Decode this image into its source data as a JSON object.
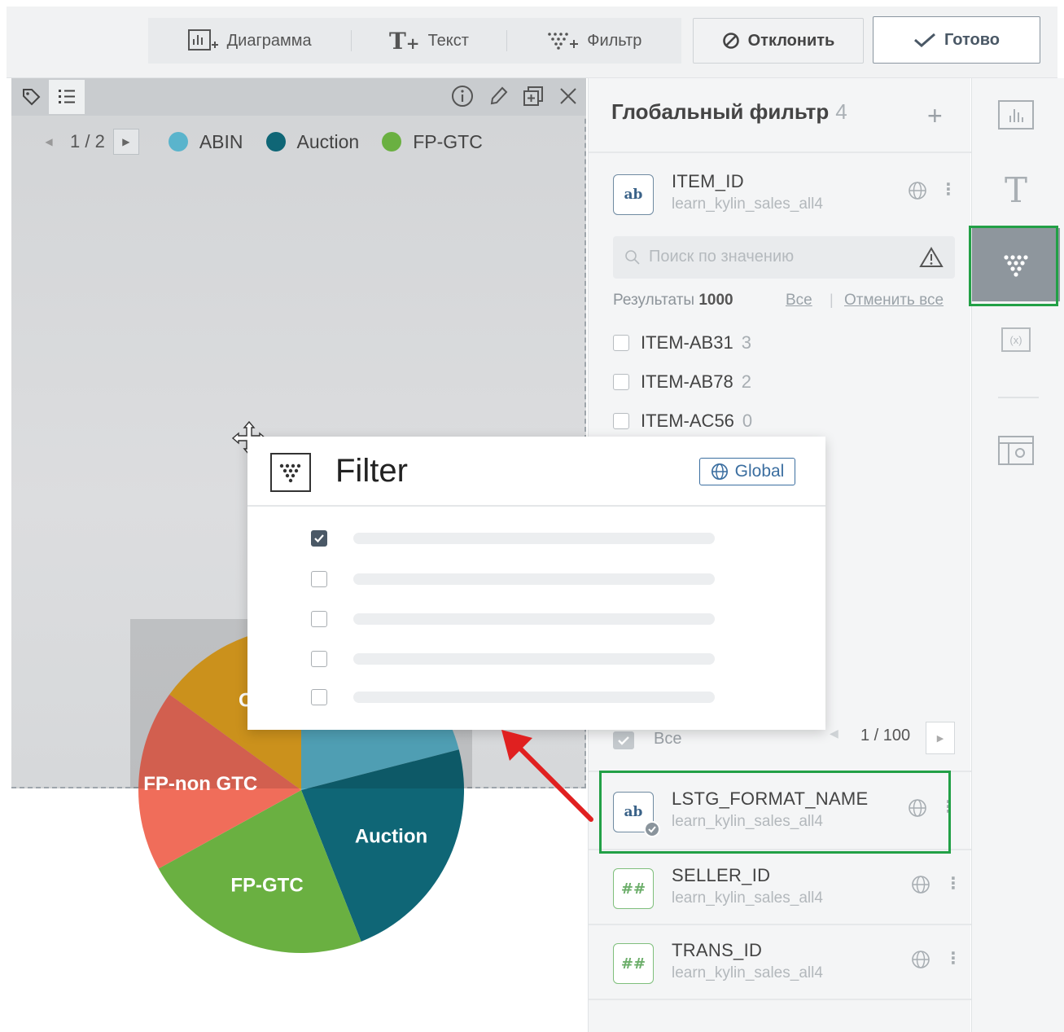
{
  "toolbar": {
    "chart_label": "Диаграмма",
    "text_label": "Текст",
    "filter_label": "Фильтр",
    "reject_label": "Отклонить",
    "done_label": "Готово"
  },
  "widget": {
    "page": "1 / 2",
    "legend": [
      {
        "label": "ABIN",
        "color": "#5ab4cc"
      },
      {
        "label": "Auction",
        "color": "#0f6676"
      },
      {
        "label": "FP-GTC",
        "color": "#6ab041"
      }
    ]
  },
  "chart_data": {
    "type": "pie",
    "slices": [
      {
        "label": "ABIN",
        "value": 21,
        "color": "#5ab4cc"
      },
      {
        "label": "Auction",
        "value": 23,
        "color": "#0f6676"
      },
      {
        "label": "FP-GTC",
        "value": 23,
        "color": "#6ab041"
      },
      {
        "label": "FP-non GTC",
        "value": 18,
        "color": "#f06d5a"
      },
      {
        "label": "Others",
        "value": 15,
        "color": "#e8a520"
      }
    ],
    "visible_labels": [
      "Oth",
      "FP-non GTC",
      "Auction",
      "FP-GTC"
    ]
  },
  "panel": {
    "title": "Глобальный фильтр",
    "count": "4",
    "fields": [
      {
        "type_label": "ab",
        "name": "ITEM_ID",
        "source": "learn_kylin_sales_all4"
      },
      {
        "type_label": "ab",
        "name": "LSTG_FORMAT_NAME",
        "source": "learn_kylin_sales_all4"
      },
      {
        "type_label": "##",
        "name": "SELLER_ID",
        "source": "learn_kylin_sales_all4"
      },
      {
        "type_label": "##",
        "name": "TRANS_ID",
        "source": "learn_kylin_sales_all4"
      }
    ],
    "search_placeholder": "Поиск по значению",
    "results_label": "Результаты",
    "results_count": "1000",
    "select_all_link": "Все",
    "clear_all_link": "Отменить все",
    "values": [
      {
        "label": "ITEM-AB31",
        "count": "3"
      },
      {
        "label": "ITEM-AB78",
        "count": "2"
      },
      {
        "label": "ITEM-AC56",
        "count": "0"
      }
    ],
    "all_label": "Все",
    "pagination": "1 / 100"
  },
  "popup": {
    "title": "Filter",
    "badge": "Global",
    "rows": [
      {
        "checked": true
      },
      {
        "checked": false
      },
      {
        "checked": false
      },
      {
        "checked": false
      },
      {
        "checked": false
      }
    ]
  },
  "rail": {
    "items": [
      "chart-icon",
      "text-icon",
      "filter-icon",
      "variable-icon",
      "screen-icon"
    ],
    "active": "filter-icon",
    "text_glyph": "T",
    "variable_glyph": "(x)"
  }
}
